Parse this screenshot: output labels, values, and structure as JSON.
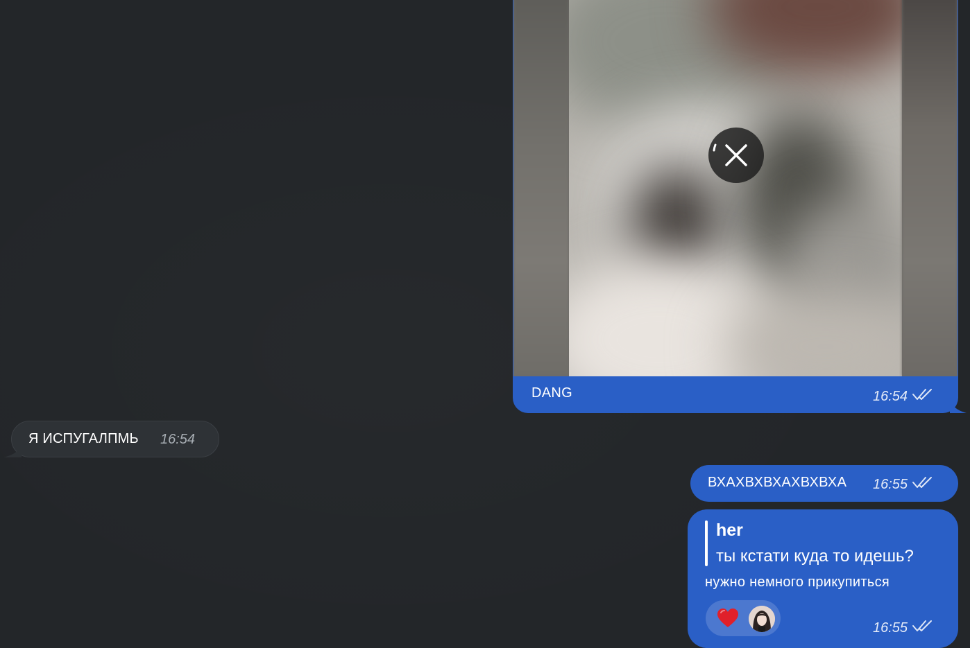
{
  "messages": {
    "media": {
      "caption": "DANG",
      "time": "16:54",
      "spoiler_icon": "close-icon",
      "read_icon": "double-check-icon"
    },
    "incoming": {
      "text": "Я ИСПУГАЛПМЬ",
      "time": "16:54"
    },
    "outgoing_short": {
      "text": "ВХАХВХВХАХВХВХА",
      "time": "16:55",
      "read_icon": "double-check-icon"
    },
    "reply": {
      "quote_author": "her",
      "quote_text": "ты кстати куда то идешь?",
      "text": "нужно немного прикупиться",
      "time": "16:55",
      "reaction_icon": "heart-icon",
      "read_icon": "double-check-icon"
    }
  },
  "colors": {
    "background": "#232629",
    "outgoing_bubble": "#2a5fc6",
    "incoming_bubble": "#2e3236",
    "heart": "#e0202a"
  }
}
